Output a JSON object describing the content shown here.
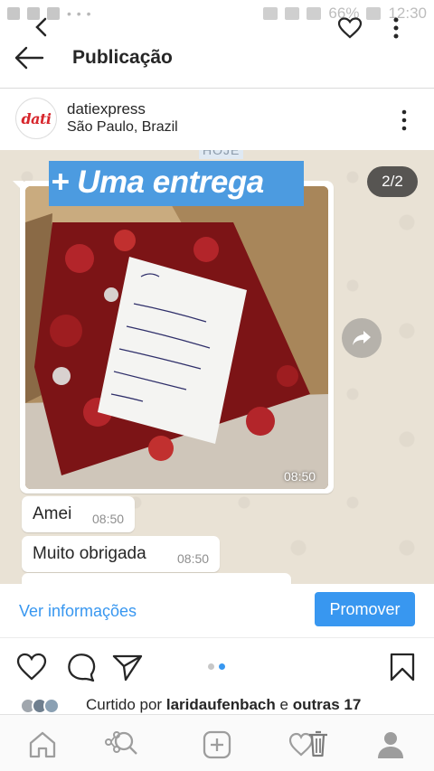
{
  "status_bar": {
    "battery": "66%",
    "time": "12:30"
  },
  "header": {
    "title": "Publicação"
  },
  "post": {
    "username": "datiexpress",
    "location": "São Paulo, Brazil",
    "avatar_text": "dati",
    "carousel_counter": "2/2",
    "photo": {
      "chat_label": "HOJE",
      "banner_text": "+ Uma entrega",
      "photo_time": "08:50",
      "messages": [
        {
          "text": "Amei",
          "time": "08:50"
        },
        {
          "text": "Muito obrigada",
          "time": "08:50"
        }
      ],
      "note_text": "Oi Stéfanie... Obrigada por comprar na Dati Express. Que você encontre um pedacinho de felicidade no seu pacote! Bjs Chris da Dati"
    }
  },
  "actions": {
    "ver_info_label": "Ver informações",
    "promover_label": "Promover"
  },
  "likes": {
    "prefix": "Curtido por",
    "user": "laridaufenbach",
    "joiner": "e",
    "others": "outras 17"
  },
  "colors": {
    "accent": "#3897f0",
    "banner": "#4c9be0",
    "brand_red": "#d7262c"
  },
  "icons": {
    "header_back": "arrow-left-icon",
    "overlay_back": "chevron-left-icon",
    "overlay_like": "heart-icon",
    "like": "heart-icon",
    "comment": "comment-icon",
    "share": "paper-plane-icon",
    "save": "bookmark-icon",
    "nav": [
      "home-icon",
      "search-icon",
      "add-icon",
      "activity-icon",
      "profile-icon"
    ]
  }
}
